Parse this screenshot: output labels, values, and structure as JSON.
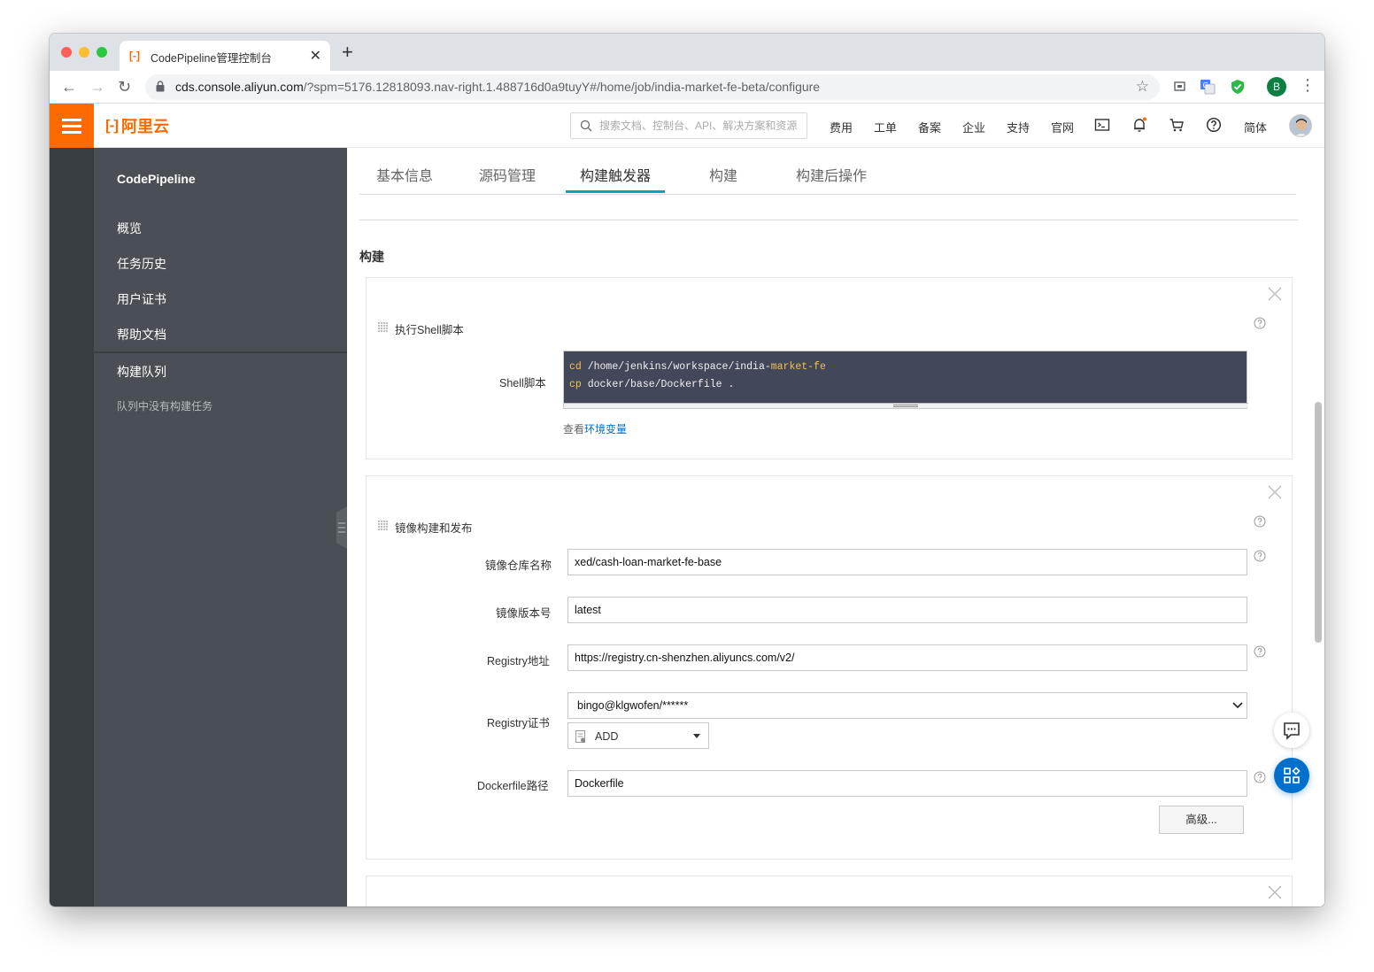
{
  "browser": {
    "tab_title": "CodePipeline管理控制台",
    "favicon": "[-]",
    "url_host": "cds.console.aliyun.com",
    "url_rest": "/?spm=5176.12818093.nav-right.1.488716d0a9tuyY#/home/job/india-market-fe-beta/configure",
    "profile_initial": "B"
  },
  "header": {
    "logo_mark": "[-]",
    "logo_text": "阿里云",
    "search_placeholder": "搜索文档、控制台、API、解决方案和资源",
    "nav": [
      "费用",
      "工单",
      "备案",
      "企业",
      "支持",
      "官网"
    ],
    "lang": "简体",
    "brand_color": "#ff6a00"
  },
  "sidebar": {
    "title": "CodePipeline",
    "items": [
      "概览",
      "任务历史",
      "用户证书",
      "帮助文档"
    ],
    "queue_title": "构建队列",
    "queue_empty": "队列中没有构建任务"
  },
  "tabs": [
    {
      "label": "基本信息",
      "active": false
    },
    {
      "label": "源码管理",
      "active": false
    },
    {
      "label": "构建触发器",
      "active": true
    },
    {
      "label": "构建",
      "active": false
    },
    {
      "label": "构建后操作",
      "active": false
    }
  ],
  "section_title": "构建",
  "shell_card": {
    "title": "执行Shell脚本",
    "label": "Shell脚本",
    "line1_cmd": "cd",
    "line1_path": " /home/jenkins/workspace/india-",
    "line1_tail": "market-fe",
    "line2_cmd": "cp",
    "line2_rest": " docker/base/Dockerfile .",
    "env_prefix": "查看",
    "env_link": "环境变量"
  },
  "image_card": {
    "title": "镜像构建和发布",
    "repo_label": "镜像仓库名称",
    "repo_value": "xed/cash-loan-market-fe-base",
    "version_label": "镜像版本号",
    "version_value": "latest",
    "registry_label": "Registry地址",
    "registry_value": "https://registry.cn-shenzhen.aliyuncs.com/v2/",
    "cert_label": "Registry证书",
    "cert_value": "bingo@klgwofen/******",
    "add_label": "ADD",
    "dockerfile_label": "Dockerfile路径",
    "dockerfile_value": "Dockerfile",
    "advanced_label": "高级..."
  },
  "accent_color": "#00a2ca",
  "link_color": "#0070cc"
}
